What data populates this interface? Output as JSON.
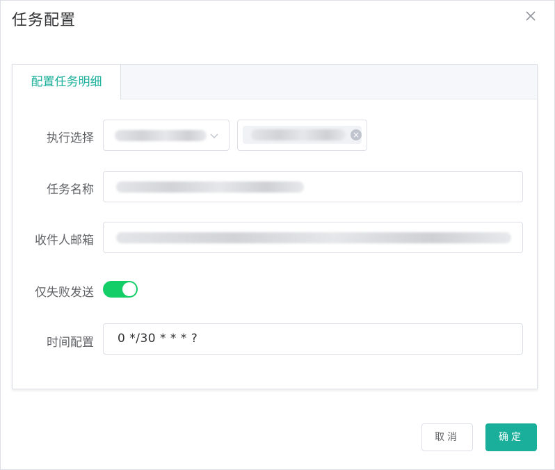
{
  "dialog": {
    "title": "任务配置",
    "close_icon": "close-icon"
  },
  "tabs": [
    {
      "label": "配置任务明细",
      "active": true
    }
  ],
  "form": {
    "exec_label": "执行选择",
    "exec_select_icon": "chevron-down-icon",
    "exec_tag_close_icon": "circle-close-icon",
    "name_label": "任务名称",
    "email_label": "收件人邮箱",
    "fail_only_label": "仅失败发送",
    "fail_only_enabled": true,
    "cron_label": "时间配置",
    "cron_value": "0 */30 * * * ?"
  },
  "footer": {
    "cancel_label": "取消",
    "ok_label": "确定"
  },
  "colors": {
    "accent": "#1aaf9a",
    "switch_on": "#13ce66"
  }
}
